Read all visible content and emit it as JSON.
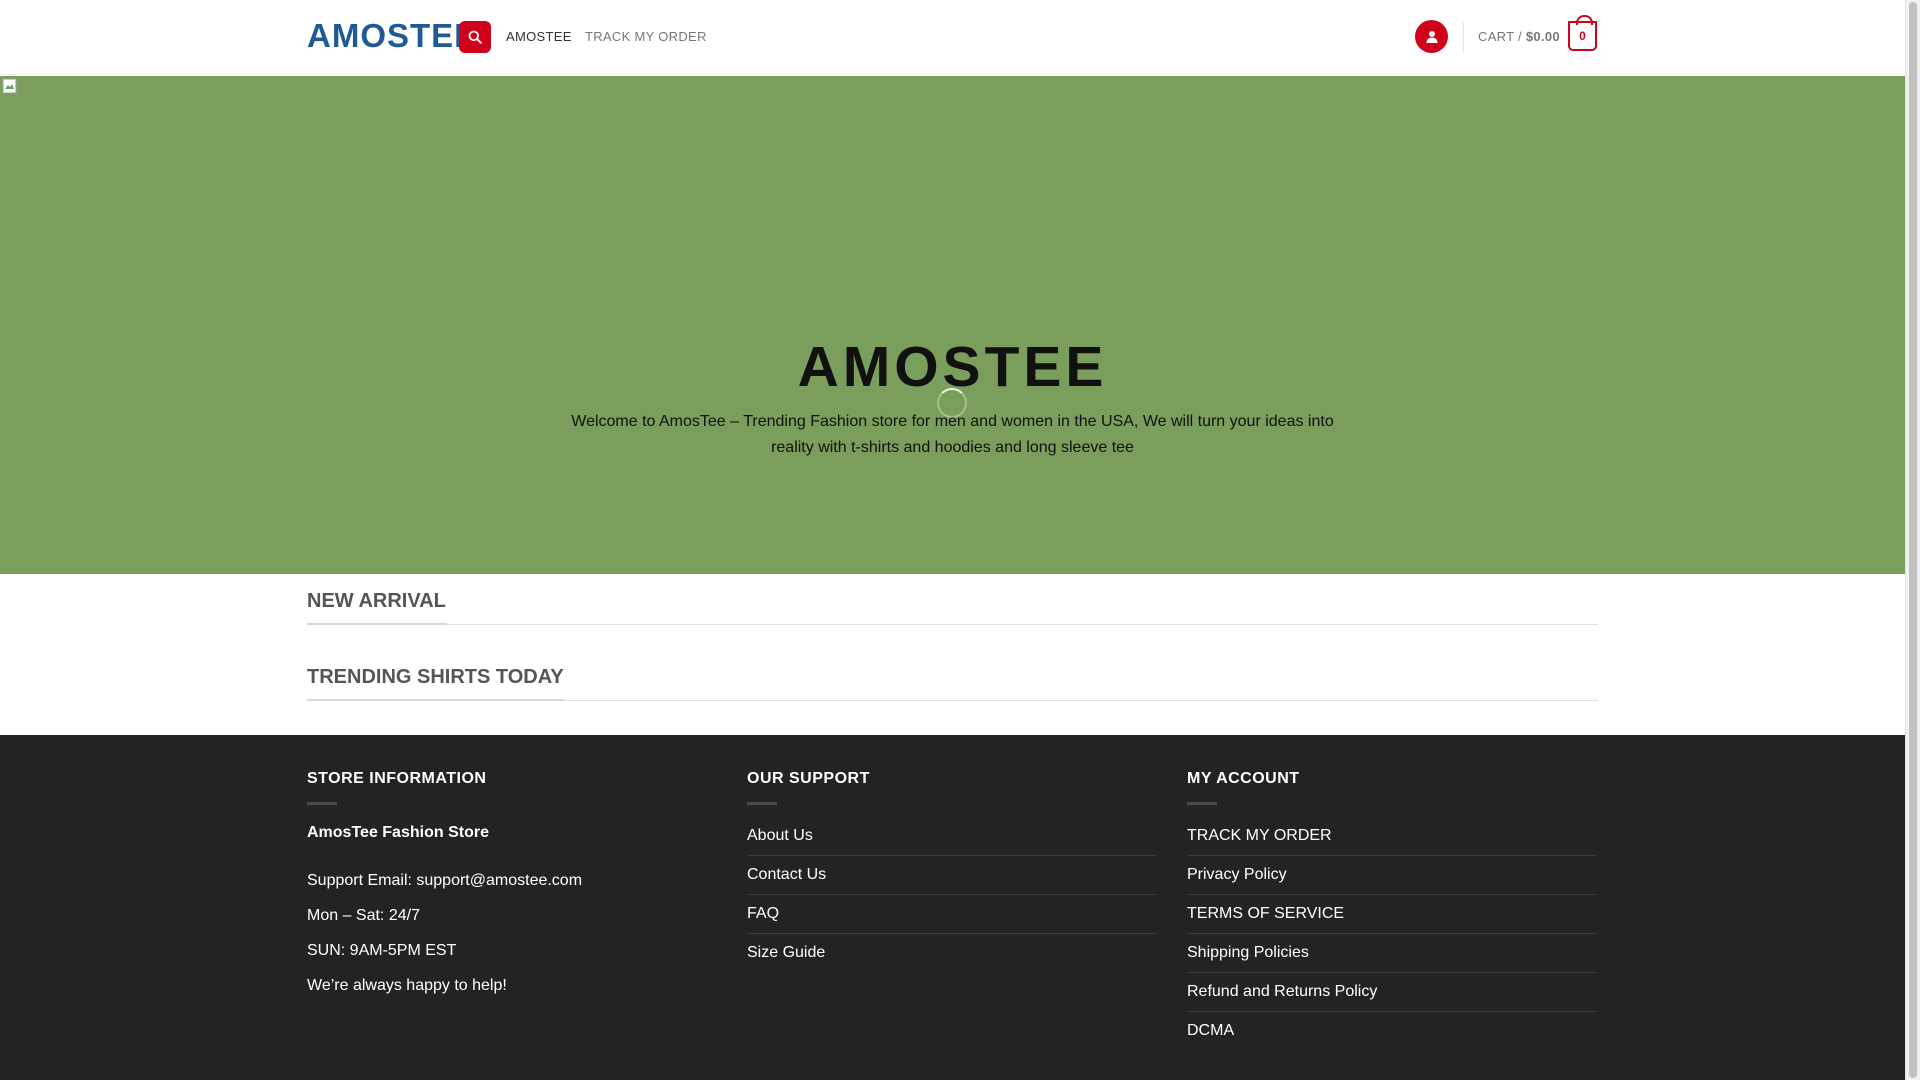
{
  "header": {
    "logo": "AMOSTEE",
    "nav": [
      {
        "label": "AMOSTEE"
      },
      {
        "label": "TRACK MY ORDER"
      }
    ],
    "cart_label": "CART / ",
    "cart_amount": "$0.00",
    "cart_count": "0",
    "colors": {
      "accent": "#d0021b",
      "logo": "#1f5a96"
    }
  },
  "hero": {
    "title": "AMOSTEE",
    "description": "Welcome to AmosTee – Trending Fashion store for men and women in the USA, We will turn your ideas into reality with t-shirts and hoodies and long sleeve tee",
    "background": "#7a9e5b"
  },
  "sections": {
    "new_arrival": "NEW ARRIVAL",
    "trending": "TRENDING SHIRTS TODAY"
  },
  "footer": {
    "store": {
      "title": "STORE INFORMATION",
      "name": "AmosTee Fashion Store",
      "lines": [
        "Support Email: support@amostee.com",
        "Mon – Sat: 24/7",
        "SUN: 9AM-5PM EST",
        "We’re always happy to help!"
      ]
    },
    "support": {
      "title": "OUR SUPPORT",
      "links": [
        "About Us",
        "Contact Us",
        "FAQ",
        "Size Guide"
      ]
    },
    "account": {
      "title": "MY ACCOUNT",
      "links": [
        "TRACK MY ORDER",
        "Privacy Policy",
        "TERMS OF SERVICE",
        "Shipping Policies",
        "Refund and Returns Policy",
        "DCMA"
      ]
    },
    "background": "#232323"
  },
  "icons": {
    "search": "search-icon",
    "account": "user-icon",
    "cart": "cart-icon"
  }
}
